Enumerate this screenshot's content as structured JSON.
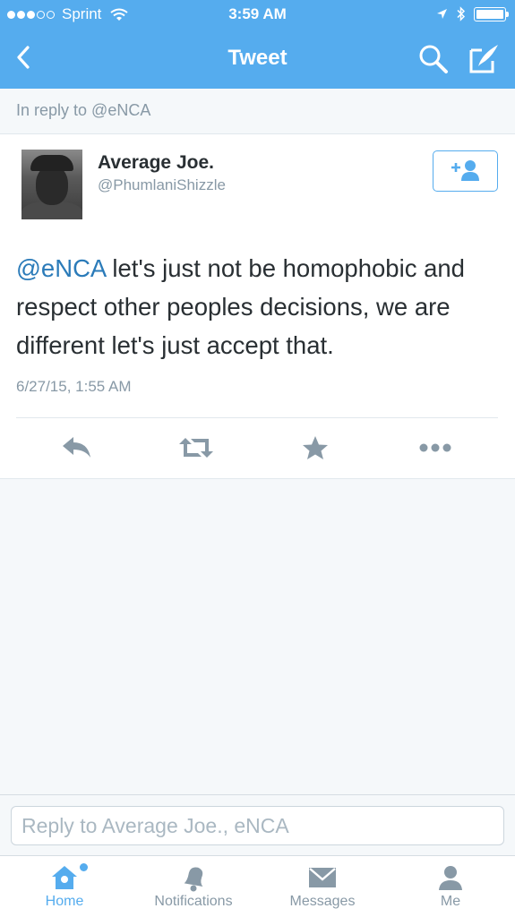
{
  "status_bar": {
    "carrier": "Sprint",
    "signal_filled": 3,
    "signal_total": 5,
    "time": "3:59 AM"
  },
  "nav": {
    "title": "Tweet",
    "back_icon": "chevron-left-icon",
    "search_icon": "search-icon",
    "compose_icon": "compose-icon"
  },
  "in_reply": {
    "text": "In reply to @eNCA"
  },
  "tweet": {
    "author_name": "Average Joe.",
    "author_handle": "@PhumlaniShizzle",
    "mention": "@eNCA",
    "body": " let's just not be homophobic and respect other peoples decisions, we are different let's just accept that.",
    "date": "6/27/15, 1:55 AM",
    "follow_icon": "add-user-icon",
    "actions": [
      "reply-icon",
      "retweet-icon",
      "favorite-icon",
      "more-icon"
    ]
  },
  "reply_bar": {
    "placeholder": "Reply to Average Joe., eNCA"
  },
  "tab_bar": {
    "tabs": [
      {
        "label": "Home",
        "icon": "home-icon",
        "active": true
      },
      {
        "label": "Notifications",
        "icon": "bell-icon",
        "active": false
      },
      {
        "label": "Messages",
        "icon": "envelope-icon",
        "active": false
      },
      {
        "label": "Me",
        "icon": "person-icon",
        "active": false
      }
    ]
  },
  "colors": {
    "brand": "#55acee",
    "link": "#2b7bb9",
    "muted": "#8899a6",
    "text": "#292f33",
    "background": "#f5f8fa"
  }
}
